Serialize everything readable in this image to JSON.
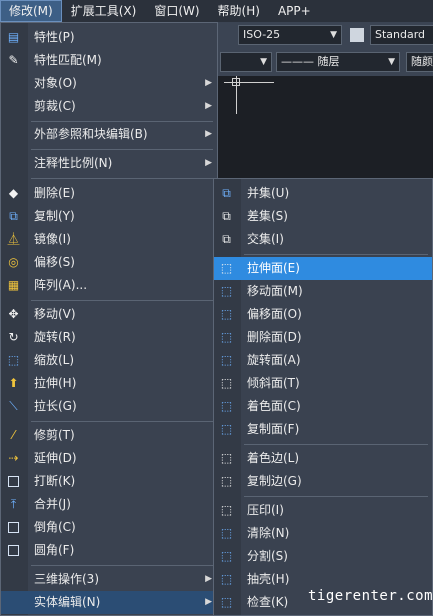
{
  "menubar": [
    "修改(M)",
    "扩展工具(X)",
    "窗口(W)",
    "帮助(H)",
    "APP+"
  ],
  "toolbar": {
    "dimstyle": "ISO-25",
    "style_name": "Standard",
    "linetype": "——— 随层",
    "next": "随颜"
  },
  "main_menu": [
    "特性(P)",
    "特性匹配(M)",
    "对象(O)",
    "剪裁(C)",
    "外部参照和块编辑(B)",
    "注释性比例(N)",
    "删除(E)",
    "复制(Y)",
    "镜像(I)",
    "偏移(S)",
    "阵列(A)...",
    "移动(V)",
    "旋转(R)",
    "缩放(L)",
    "拉伸(H)",
    "拉长(G)",
    "修剪(T)",
    "延伸(D)",
    "打断(K)",
    "合并(J)",
    "倒角(C)",
    "圆角(F)",
    "三维操作(3)",
    "实体编辑(N)"
  ],
  "sub_menu": [
    "并集(U)",
    "差集(S)",
    "交集(I)",
    "拉伸面(E)",
    "移动面(M)",
    "偏移面(O)",
    "删除面(D)",
    "旋转面(A)",
    "倾斜面(T)",
    "着色面(C)",
    "复制面(F)",
    "着色边(L)",
    "复制边(G)",
    "压印(I)",
    "清除(N)",
    "分割(S)",
    "抽壳(H)",
    "检查(K)"
  ],
  "watermark": "tigerenter.com",
  "colors": {
    "highlight": "#2f8be0",
    "menu_bg": "#3a4250",
    "menubar_bg": "#2b313b"
  }
}
